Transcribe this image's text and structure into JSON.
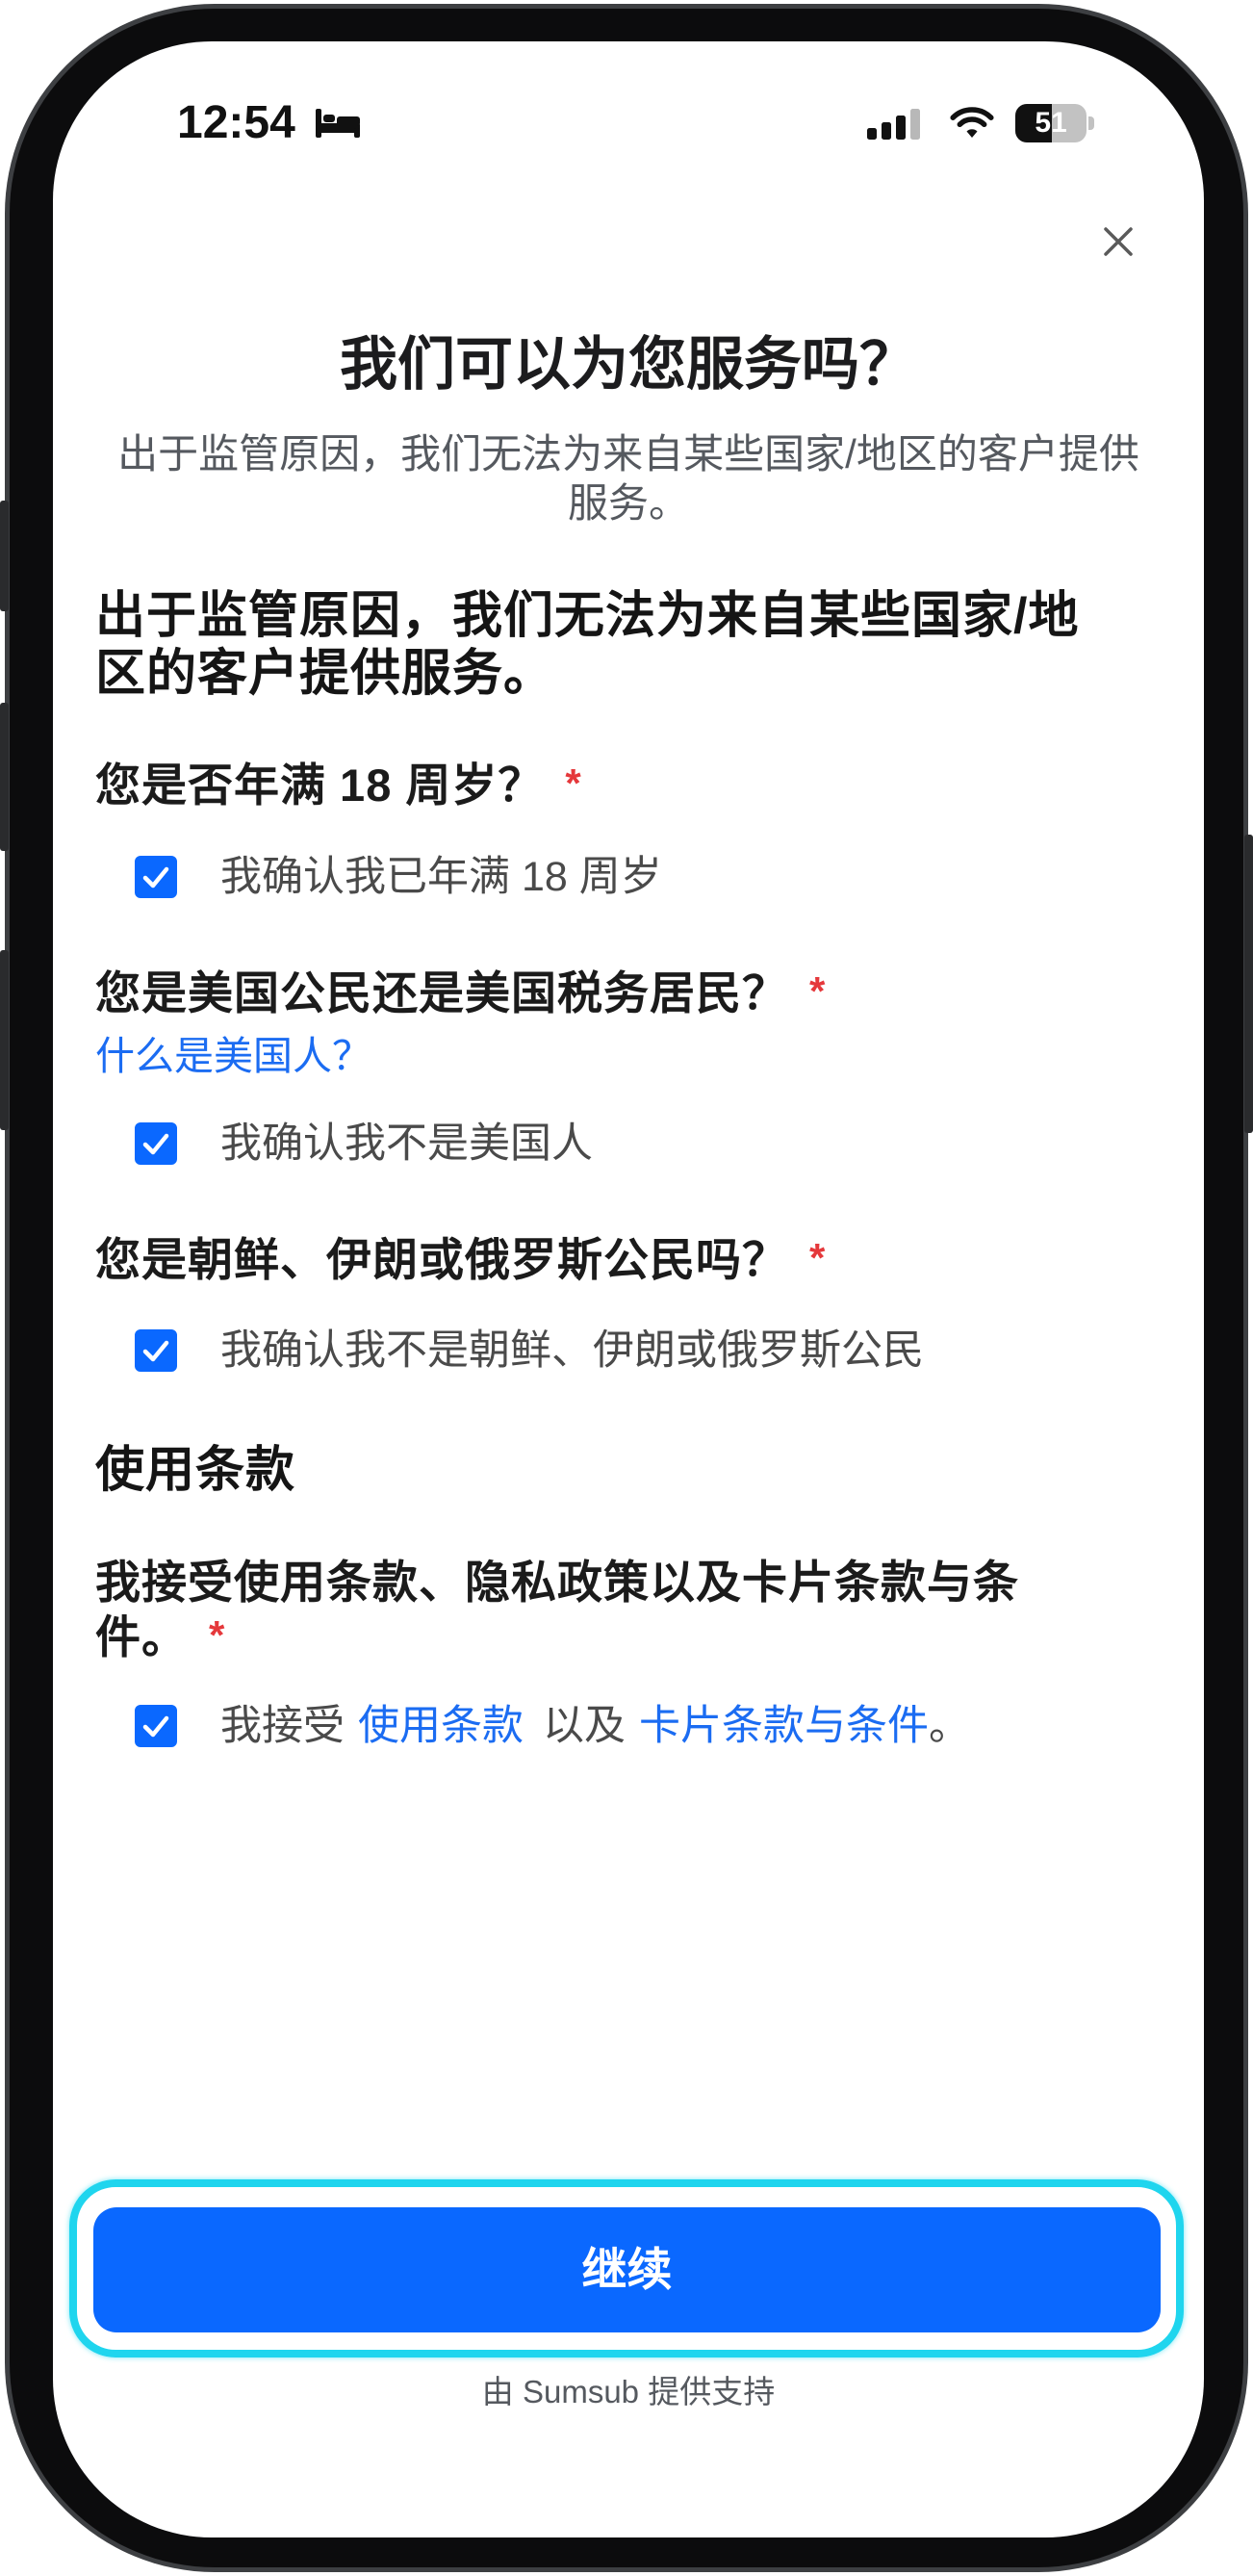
{
  "status_bar": {
    "time": "12:54",
    "battery": "51",
    "signal_bars": 3,
    "icons": [
      "bed-icon",
      "cellular-signal-icon",
      "wifi-icon",
      "battery-icon"
    ]
  },
  "close_icon": "close-icon",
  "title": "我们可以为您服务吗？",
  "subtitle": "出于监管原因，我们无法为来自某些国家/地区的客户提供服务。",
  "section_heading": "出于监管原因，我们无法为来自某些国家/地区的客户提供服务。",
  "questions": [
    {
      "label": "您是否年满 18 周岁？",
      "required_mark": "*",
      "checkbox": {
        "checked": true,
        "label": "我确认我已年满 18 周岁"
      }
    },
    {
      "label": "您是美国公民还是美国税务居民？",
      "required_mark": "*",
      "help_link": "什么是美国人？",
      "checkbox": {
        "checked": true,
        "label": "我确认我不是美国人"
      }
    },
    {
      "label": "您是朝鲜、伊朗或俄罗斯公民吗？",
      "required_mark": "*",
      "checkbox": {
        "checked": true,
        "label": "我确认我不是朝鲜、伊朗或俄罗斯公民"
      }
    }
  ],
  "terms": {
    "heading": "使用条款",
    "label": "我接受使用条款、隐私政策以及卡片条款与条件。",
    "required_mark": "*",
    "checkbox": {
      "checked": true,
      "prefix": "我接受",
      "terms_link": "使用条款",
      "middle": "以及",
      "card_terms_link": "卡片条款与条件",
      "suffix": "。"
    }
  },
  "continue_button": {
    "label": "继续"
  },
  "footer": {
    "powered_by": "由 Sumsub 提供支持"
  },
  "colors": {
    "accent": "#0a68ff",
    "link": "#1b6cf2",
    "required": "#e5383b",
    "highlight": "#1fd5ee",
    "title_text": "#1c1c1e",
    "secondary_text": "#55595f"
  }
}
